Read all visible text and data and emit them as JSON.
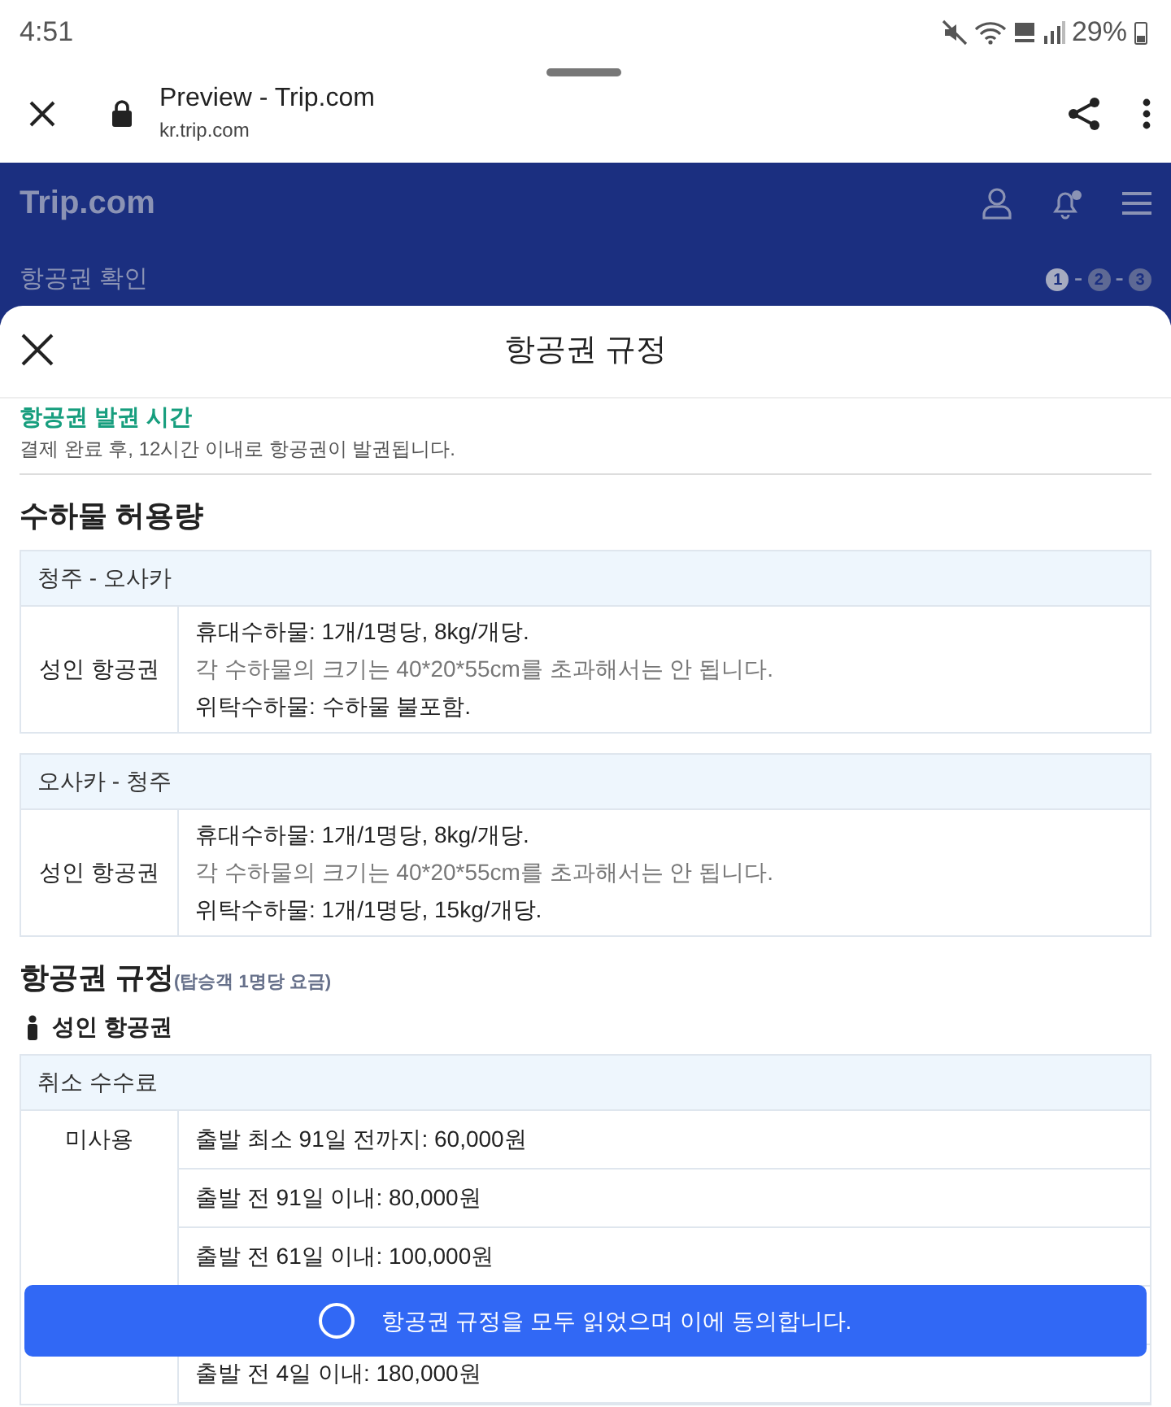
{
  "status_bar": {
    "time": "4:51",
    "battery": "29%"
  },
  "browser": {
    "title": "Preview - Trip.com",
    "url": "kr.trip.com"
  },
  "site_header": {
    "logo": "Trip.com",
    "page_title": "항공권 확인",
    "steps": [
      {
        "label": "1",
        "selected": true
      },
      {
        "label": "2",
        "selected": false
      },
      {
        "label": "3",
        "selected": false
      }
    ],
    "step_separator": "-"
  },
  "sheet": {
    "title": "항공권 규정",
    "issue": {
      "heading": "항공권 발권 시간",
      "text": "결제 완료 후, 12시간 이내로 항공권이 발권됩니다."
    },
    "baggage": {
      "heading": "수하물 허용량",
      "tables": [
        {
          "route": "청주 - 오사카",
          "passenger": "성인 항공권",
          "lines": [
            {
              "text": "휴대수하물: 1개/1명당, 8kg/개당.",
              "muted": false
            },
            {
              "text": "각 수하물의 크기는 40*20*55cm를 초과해서는 안 됩니다.",
              "muted": true
            },
            {
              "text": "위탁수하물: 수하물 불포함.",
              "muted": false
            }
          ]
        },
        {
          "route": "오사카 - 청주",
          "passenger": "성인 항공권",
          "lines": [
            {
              "text": "휴대수하물: 1개/1명당, 8kg/개당.",
              "muted": false
            },
            {
              "text": "각 수하물의 크기는 40*20*55cm를 초과해서는 안 됩니다.",
              "muted": true
            },
            {
              "text": "위탁수하물: 1개/1명당, 15kg/개당.",
              "muted": false
            }
          ]
        }
      ]
    },
    "rules": {
      "heading": "항공권 규정",
      "note": "(탑승객 1명당 요금)",
      "passenger": "성인 항공권",
      "table": {
        "title": "취소 수수료",
        "label": "미사용",
        "rows": [
          "출발 최소 91일 전까지: 60,000원",
          "출발 전 91일 이내: 80,000원",
          "출발 전 61일 이내: 100,000원",
          null,
          "출발 전 4일 이내: 180,000원"
        ]
      }
    },
    "agree_button": {
      "label": "항공권 규정을 모두 읽었으며 이에 동의합니다.",
      "checked": false
    }
  }
}
